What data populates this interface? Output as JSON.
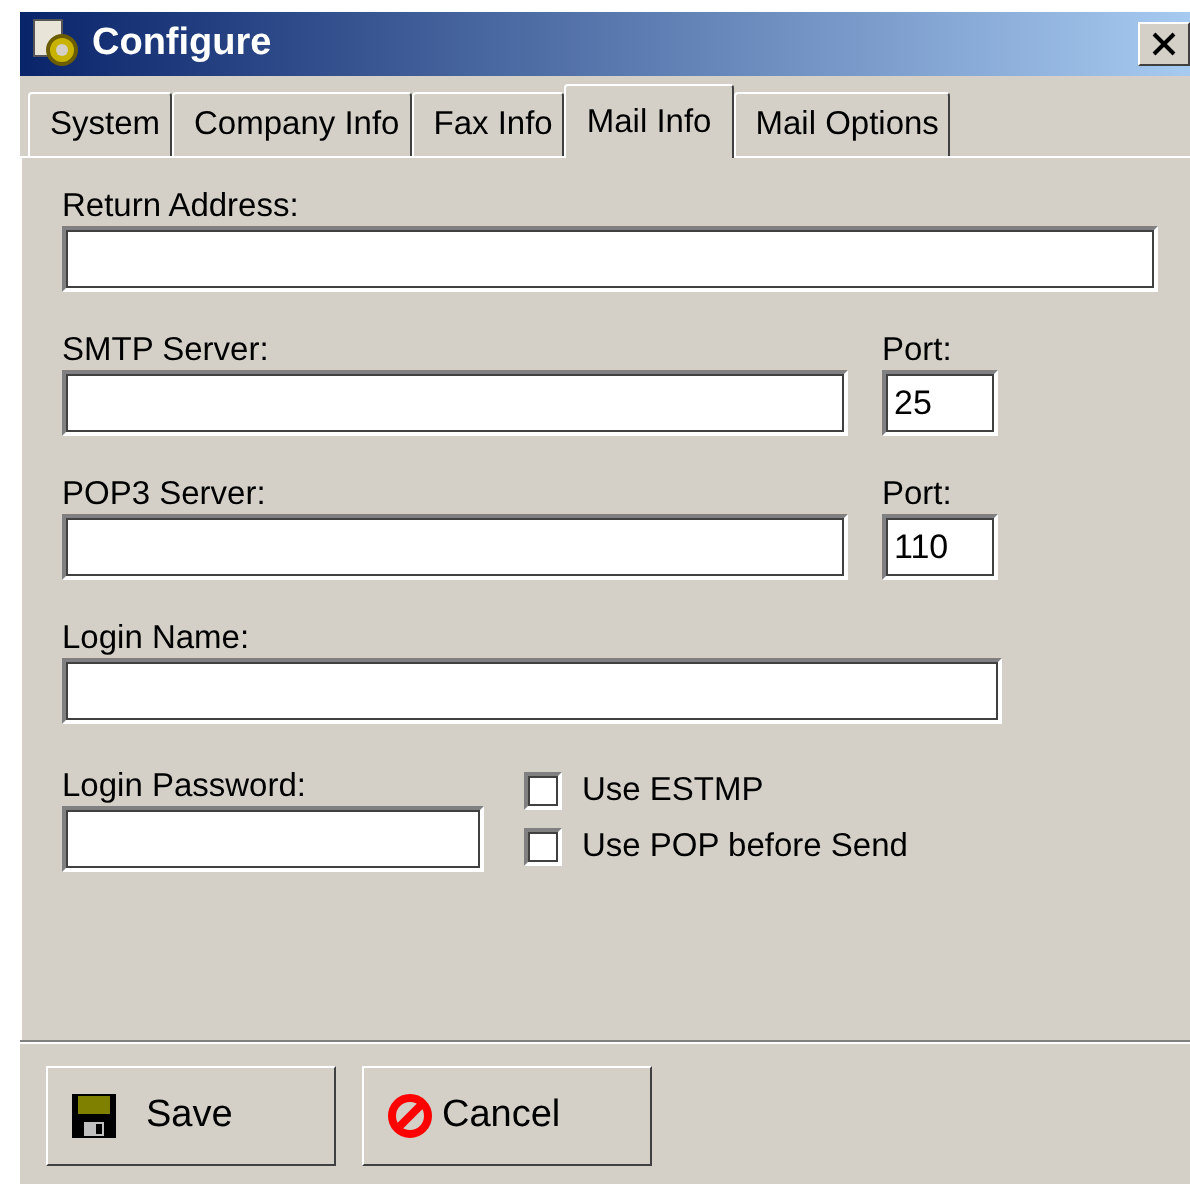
{
  "window": {
    "title": "Configure"
  },
  "tabs": [
    {
      "label": "System",
      "selected": false
    },
    {
      "label": "Company Info",
      "selected": false
    },
    {
      "label": "Fax Info",
      "selected": false
    },
    {
      "label": "Mail Info",
      "selected": true
    },
    {
      "label": "Mail Options",
      "selected": false
    }
  ],
  "rows": [
    {
      "fields": [
        {
          "label": "Return Address:",
          "kind": "full"
        }
      ]
    },
    {
      "fields": [
        {
          "label": "SMTP Server:",
          "kind": "server"
        },
        {
          "label": "Port:",
          "value": "25",
          "kind": "port"
        }
      ]
    },
    {
      "fields": [
        {
          "label": "POP3 Server:",
          "kind": "server"
        },
        {
          "label": "Port:",
          "value": "110",
          "kind": "port"
        }
      ]
    },
    {
      "fields": [
        {
          "label": "Login Name:",
          "kind": "wide"
        }
      ]
    },
    {
      "fields": [
        {
          "label": "Login Password:",
          "kind": "short"
        }
      ],
      "checkboxes": [
        {
          "label": "Use ESTMP",
          "checked": false
        },
        {
          "label": "Use POP before Send",
          "checked": false
        }
      ]
    }
  ],
  "buttons": [
    {
      "label": "Save",
      "kind": "save"
    },
    {
      "label": "Cancel",
      "kind": "cancel"
    }
  ]
}
